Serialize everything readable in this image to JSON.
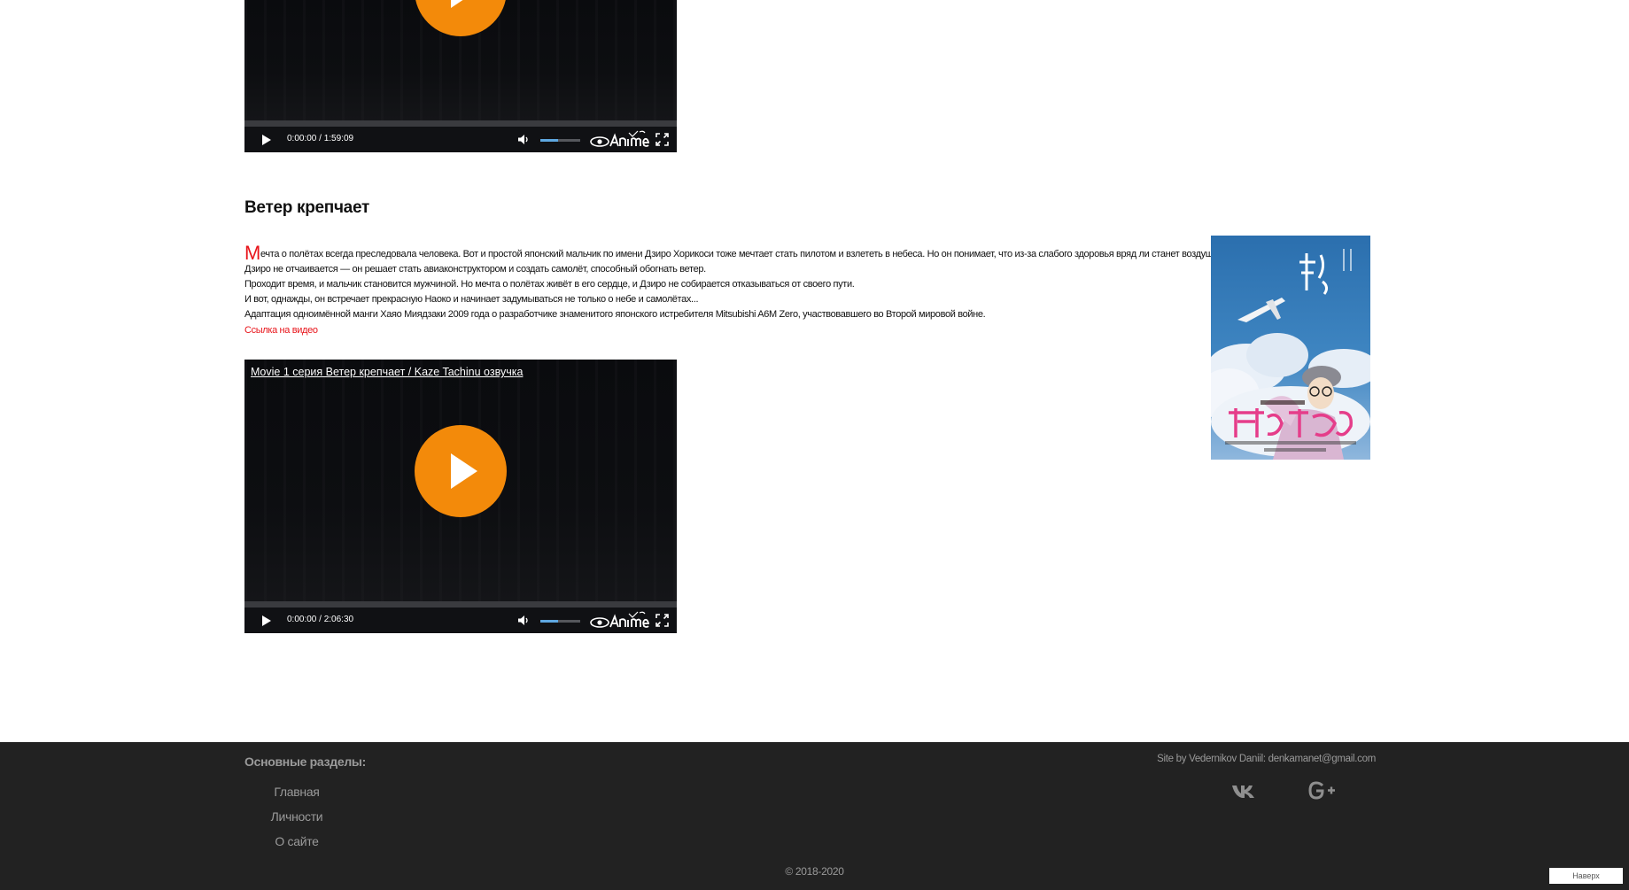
{
  "players": [
    {
      "title": "",
      "time": "0:00:00 / 1:59:09",
      "volume_level": 0.45
    },
    {
      "title": "Movie 1 серия Ветер крепчает / Kaze Tachinu озвучка",
      "time": "0:00:00 / 2:06:30",
      "volume_level": 0.45
    }
  ],
  "article": {
    "title": "Ветер крепчает",
    "drop_cap": "М",
    "first_line": "ечта о полётах всегда преследовала человека. Вот и простой японский мальчик по имени Дзиро Хорикоси тоже мечтает стать пилотом и взлететь в небеса. Но он понимает, что из-за слабого здоровья вряд ли станет воздушным асом.",
    "lines": [
      "Дзиро не отчаивается — он решает стать авиаконструктором и создать самолёт, способный обогнать ветер.",
      "Проходит время, и мальчик становится мужчиной. Но мечта о полётах живёт в его сердце, и Дзиро не собирается отказываться от своего пути.",
      "И вот, однажды, он встречает прекрасную Наоко и начинает задумываться не только о небе и самолётах...",
      "Адаптация одноимённой манги Хаяо Миядзаки 2009 года о разработчике знаменитого японского истребителя Mitsubishi A6M Zero, участвовавшего во Второй мировой войне."
    ],
    "video_link": "Ссылка на видео"
  },
  "footer": {
    "heading": "Основные разделы:",
    "nav": [
      "Главная",
      "Личности",
      "О сайте"
    ],
    "credit": "Site by Vedernikov Daniil: denkamanet@gmail.com",
    "social": [
      "vk-icon",
      "google-plus-icon"
    ],
    "copyright": "© 2018-2020",
    "back_to_top": "Наверх"
  },
  "colors": {
    "accent_red": "#e8141a",
    "play_orange": "#f38a0a",
    "footer_bg": "#222222",
    "footer_text": "#9a9a9a"
  }
}
